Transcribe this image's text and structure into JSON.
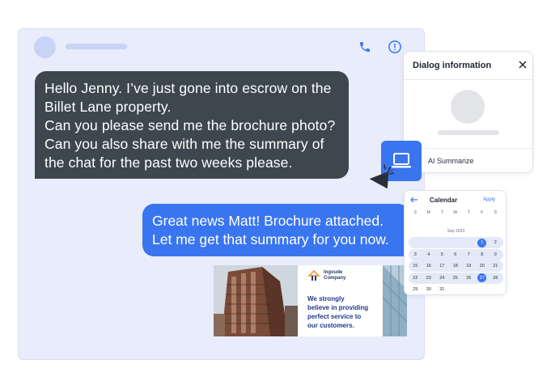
{
  "chat": {
    "incoming_lines": [
      "Hello Jenny. I’ve just gone into escrow on the",
      "Billet Lane property.",
      "Can you please send me the brochure photo?",
      "Can you also share with me the summary of",
      "the chat for the past two weeks please."
    ],
    "outgoing_lines": [
      "Great news Matt! Brochure attached.",
      "Let me get that summary for you now."
    ]
  },
  "brochure": {
    "company_lines": [
      "Ingoude",
      "Company"
    ],
    "tagline_lines": [
      "We strongly",
      "believe in providing",
      "perfect service to",
      "our customers."
    ]
  },
  "dialog": {
    "title": "Dialog information",
    "ai_label": "AI Summarize"
  },
  "calendar": {
    "title": "Calendar",
    "apply": "Apply",
    "dows": [
      "S",
      "M",
      "T",
      "W",
      "T",
      "F",
      "S"
    ],
    "month": "Sep 2023",
    "weeks": [
      [
        "",
        "",
        "",
        "",
        "",
        "1",
        "2"
      ],
      [
        "3",
        "4",
        "5",
        "6",
        "7",
        "8",
        "9"
      ],
      [
        "15",
        "16",
        "17",
        "18",
        "19",
        "20",
        "21"
      ],
      [
        "22",
        "23",
        "24",
        "25",
        "26",
        "27",
        "28"
      ],
      [
        "29",
        "30",
        "31",
        "",
        "",
        "",
        ""
      ]
    ],
    "selected": [
      "1",
      "27"
    ]
  },
  "colors": {
    "accent": "#3a75f0",
    "incoming_bubble": "#3d474d",
    "chat_bg": "#e8ecfb"
  }
}
